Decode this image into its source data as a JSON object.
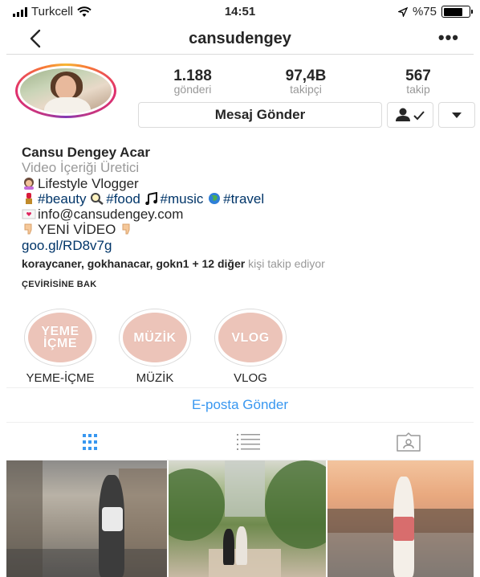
{
  "status_bar": {
    "carrier": "Turkcell",
    "time": "14:51",
    "battery": "%75",
    "battery_level": 0.75
  },
  "nav": {
    "title": "cansudengey",
    "more_label": "•••"
  },
  "stats": [
    {
      "value": "1.188",
      "label": "gönderi"
    },
    {
      "value": "97,4B",
      "label": "takipçi"
    },
    {
      "value": "567",
      "label": "takip"
    }
  ],
  "actions": {
    "message_label": "Mesaj Gönder"
  },
  "bio": {
    "full_name": "Cansu Dengey Acar",
    "category": "Video İçeriği Üretici",
    "line1": "Lifestyle Vlogger",
    "tag_beauty": "#beauty",
    "tag_food": "#food",
    "tag_music": "#music",
    "tag_travel": "#travel",
    "email": "info@cansudengey.com",
    "new_video": "YENİ VİDEO",
    "link": "goo.gl/RD8v7g"
  },
  "followed_by": {
    "users": "koraycaner, gokhanacar, gokn1",
    "others": "+ 12 diğer",
    "suffix": "kişi takip ediyor"
  },
  "translate_label": "ÇEVİRİSİNE BAK",
  "highlights": [
    {
      "cover_text": "YEME İÇME",
      "label": "YEME-İÇME"
    },
    {
      "cover_text": "MÜZİK",
      "label": "MÜZİK"
    },
    {
      "cover_text": "VLOG",
      "label": "VLOG"
    }
  ],
  "email_button": "E-posta Gönder",
  "colors": {
    "link_blue": "#3897f0",
    "hashtag": "#003569",
    "highlight_pink": "#ecc4b9"
  }
}
